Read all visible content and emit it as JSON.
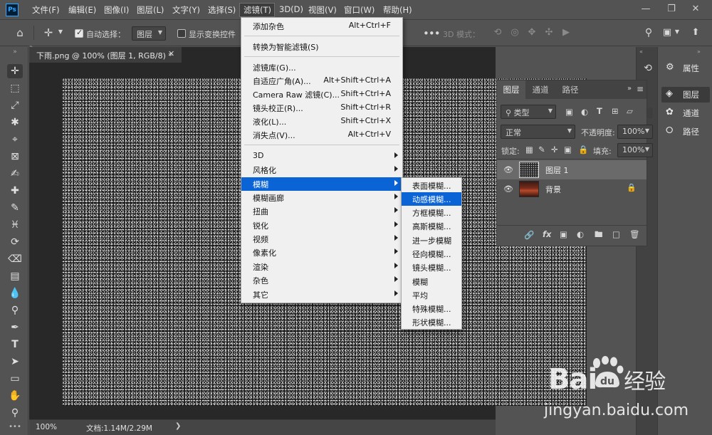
{
  "app": {
    "logo": "Ps",
    "menus": [
      "文件(F)",
      "编辑(E)",
      "图像(I)",
      "图层(L)",
      "文字(Y)",
      "选择(S)",
      "滤镜(T)",
      "3D(D)",
      "视图(V)",
      "窗口(W)",
      "帮助(H)"
    ],
    "window_controls": [
      "minimize-icon",
      "maximize-icon",
      "close-icon"
    ]
  },
  "options_bar": {
    "home_icon": "home-icon",
    "move_icon": "move-tool-icon",
    "auto_select_label": "自动选择：",
    "auto_select_checked": true,
    "auto_select_target": "图层",
    "show_transform_label": "显示变换控件",
    "show_transform_checked": false,
    "mode_3d_label": "3D 模式："
  },
  "document": {
    "tab_title": "下雨.png @ 100% (图层 1, RGB/8) *",
    "zoom": "100%",
    "doc_info": "文档:1.14M/2.29M"
  },
  "filter_menu": {
    "items": [
      {
        "label": "添加杂色",
        "shortcut": "Alt+Ctrl+F"
      },
      {
        "label": "转换为智能滤镜(S)",
        "shortcut": ""
      },
      {
        "label": "滤镜库(G)...",
        "shortcut": ""
      },
      {
        "label": "自适应广角(A)...",
        "shortcut": "Alt+Shift+Ctrl+A"
      },
      {
        "label": "Camera Raw 滤镜(C)...",
        "shortcut": "Shift+Ctrl+A"
      },
      {
        "label": "镜头校正(R)...",
        "shortcut": "Shift+Ctrl+R"
      },
      {
        "label": "液化(L)...",
        "shortcut": "Shift+Ctrl+X"
      },
      {
        "label": "消失点(V)...",
        "shortcut": "Alt+Ctrl+V"
      }
    ],
    "submenus": [
      "3D",
      "风格化",
      "模糊",
      "模糊画廊",
      "扭曲",
      "锐化",
      "视频",
      "像素化",
      "渲染",
      "杂色",
      "其它"
    ],
    "highlighted": "模糊"
  },
  "blur_submenu": {
    "items": [
      "表面模糊...",
      "动感模糊...",
      "方框模糊...",
      "高斯模糊...",
      "进一步模糊",
      "径向模糊...",
      "镜头模糊...",
      "模糊",
      "平均",
      "特殊模糊...",
      "形状模糊..."
    ],
    "highlighted": "动感模糊..."
  },
  "layers_panel": {
    "tabs": [
      "图层",
      "通道",
      "路径"
    ],
    "filter_kind": "类型",
    "blend_mode": "正常",
    "opacity_label": "不透明度:",
    "opacity_value": "100%",
    "lock_label": "锁定:",
    "fill_label": "填充:",
    "fill_value": "100%",
    "layers": [
      {
        "name": "图层 1",
        "selected": true,
        "locked": false
      },
      {
        "name": "背景",
        "selected": false,
        "locked": true
      }
    ]
  },
  "dock": {
    "items": [
      "属性",
      "图层",
      "通道",
      "路径"
    ]
  },
  "watermark": {
    "logo_text": "Bai",
    "logo_suffix": "经验",
    "url": "jingyan.baidu.com"
  },
  "colors": {
    "highlight": "#0a64d6",
    "ui_bg": "#535353",
    "canvas_bg": "#1b1b1b"
  }
}
